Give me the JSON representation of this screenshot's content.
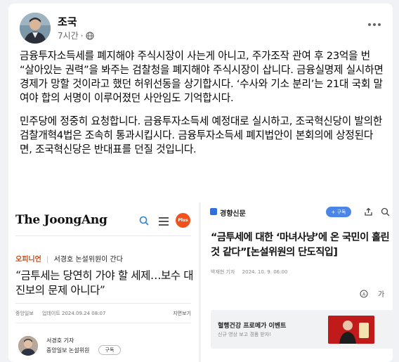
{
  "post": {
    "author": "조국",
    "time": "7시간",
    "paragraphs": [
      "금융투자소득세를 폐지해야 주식시장이 사는게 아니고, 주가조작 관여 후 23억을 번 “살아있는 권력”을 봐주는 검찰청을 폐지해야 주식시장이 삽니다. 금융실명제 실시하면 경제가 망할 것이라고 했던 허위선동을 상기합시다. ‘수사와 기소 분리’는 21대 국회 말 여야 합의 서명이 이루어졌던 사안임도 기억합시다.",
      "민주당에 정중히 요청합니다. 금융투자소득세 예정대로 실시하고, 조국혁신당이 발의한 검찰개혁4법은 조속히 통과시킵시다. 금융투자소득세 폐지법안이 본회의에 상정된다면, 조국혁신당은 반대표를 던질 것입니다."
    ]
  },
  "left_image": {
    "logo": "The JoongAng",
    "plus_badge": "Plus",
    "opinion_tag": "오피니언",
    "column": "서경호 논설위원이 간다",
    "headline": "“금투세는 당연히 가야 할 세제…보수 대 진보의 문제 아니다”",
    "source": "중앙일보",
    "updated": "업데이트 2024.09.24 08:07",
    "layout_label": "지면보기",
    "reporter_name": "서경호 기자",
    "reporter_role": "중앙일보 논설위원",
    "subscribe": "구독"
  },
  "right_image": {
    "logo": "경향신문",
    "subscribe": "+ 구독",
    "headline": "“금투세에 대한 ‘마녀사냥’에 온 국민이 홀린 것 같다”[논설위원의 단도직입]",
    "reporter": "박재현 기자",
    "date": "2024. 10. 9. 06:00",
    "font_tool": "가",
    "ad_title": "혈행건강 프로메가 이벤트",
    "ad_sub": "신규 영상 보고 경품 받자!"
  },
  "colors": {
    "background": "#f0f2f5",
    "card": "#ffffff",
    "secondary_text": "#65676b",
    "joongang_accent": "#f2511b",
    "kyunghyang_blue": "#4a86e8"
  }
}
